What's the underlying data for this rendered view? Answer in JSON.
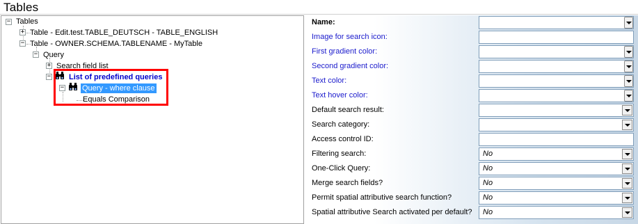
{
  "window": {
    "title": "Tables"
  },
  "tree": {
    "root": "Tables",
    "items": [
      {
        "label": "Table - Edit.test.TABLE_DEUTSCH - TABLE_ENGLISH"
      },
      {
        "label": "Table - OWNER.SCHEMA.TABLENAME - MyTable"
      },
      {
        "label": "Query"
      },
      {
        "label": "Search field list"
      },
      {
        "label": "List of predefined queries"
      },
      {
        "label": "Query - where clause"
      },
      {
        "label": "Equals Comparison"
      }
    ]
  },
  "properties": [
    {
      "label": "Name:",
      "value": "",
      "dropdown": true
    },
    {
      "label": "Image for search icon:",
      "value": "",
      "dropdown": false
    },
    {
      "label": "First gradient color:",
      "value": "",
      "dropdown": true
    },
    {
      "label": "Second gradient color:",
      "value": "",
      "dropdown": true
    },
    {
      "label": "Text color:",
      "value": "",
      "dropdown": true
    },
    {
      "label": "Text hover color:",
      "value": "",
      "dropdown": true
    },
    {
      "label": "Default search result:",
      "value": "",
      "dropdown": true
    },
    {
      "label": "Search category:",
      "value": "",
      "dropdown": true
    },
    {
      "label": "Access control ID:",
      "value": "",
      "dropdown": false
    },
    {
      "label": "Filtering search:",
      "value": "No",
      "dropdown": true
    },
    {
      "label": "One-Click Query:",
      "value": "No",
      "dropdown": true
    },
    {
      "label": "Merge search fields?",
      "value": "No",
      "dropdown": true
    },
    {
      "label": "Permit spatial attributive search function?",
      "value": "No",
      "dropdown": true
    },
    {
      "label": "Spatial attributive Search activated per default?",
      "value": "No",
      "dropdown": true
    }
  ],
  "colors": {
    "selection": "#3399ff",
    "highlight": "#ff0000",
    "blue_label": "#1a1acc"
  }
}
